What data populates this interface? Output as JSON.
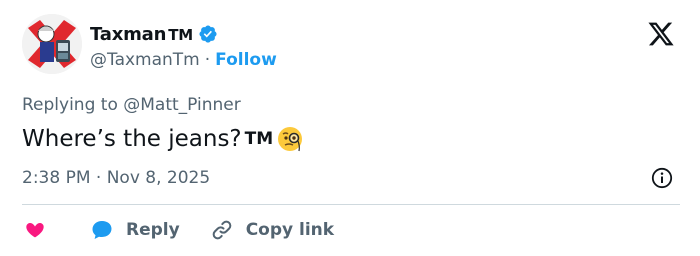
{
  "author": {
    "display_name": "Taxman",
    "name_suffix": "TM",
    "handle": "@TaxmanTm",
    "separator": "·",
    "follow_label": "Follow"
  },
  "icons": {
    "verified": "verified-badge-icon",
    "x_logo": "x-logo-icon",
    "info": "info-icon",
    "like": "heart-icon",
    "reply": "speech-bubble-icon",
    "copy_link": "link-icon",
    "emoji": "monocle-face-emoji"
  },
  "colors": {
    "accent": "#1d9bf0",
    "like": "#f91880",
    "text_primary": "#0f1419",
    "text_secondary": "#536471"
  },
  "reply_context": "Replying to @Matt_Pinner",
  "tweet": {
    "text": "Where’s the jeans?",
    "tm_mark": "TM"
  },
  "timestamp": "2:38 PM · Nov 8, 2025",
  "actions": {
    "reply_label": "Reply",
    "copy_link_label": "Copy link"
  }
}
